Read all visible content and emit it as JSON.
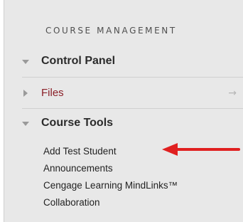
{
  "section": {
    "title": "COURSE MANAGEMENT"
  },
  "control_panel": {
    "label": "Control Panel",
    "expanded": true
  },
  "files": {
    "label": "Files",
    "expanded": false,
    "link_color": "#8a1f27"
  },
  "course_tools": {
    "label": "Course Tools",
    "expanded": true,
    "items": [
      {
        "label": "Add Test Student",
        "highlighted": true
      },
      {
        "label": "Announcements"
      },
      {
        "label": "Cengage Learning MindLinks™"
      },
      {
        "label": "Collaboration"
      }
    ]
  },
  "annotation": {
    "type": "red-arrow",
    "color": "#e02020",
    "points_to": "Add Test Student"
  }
}
